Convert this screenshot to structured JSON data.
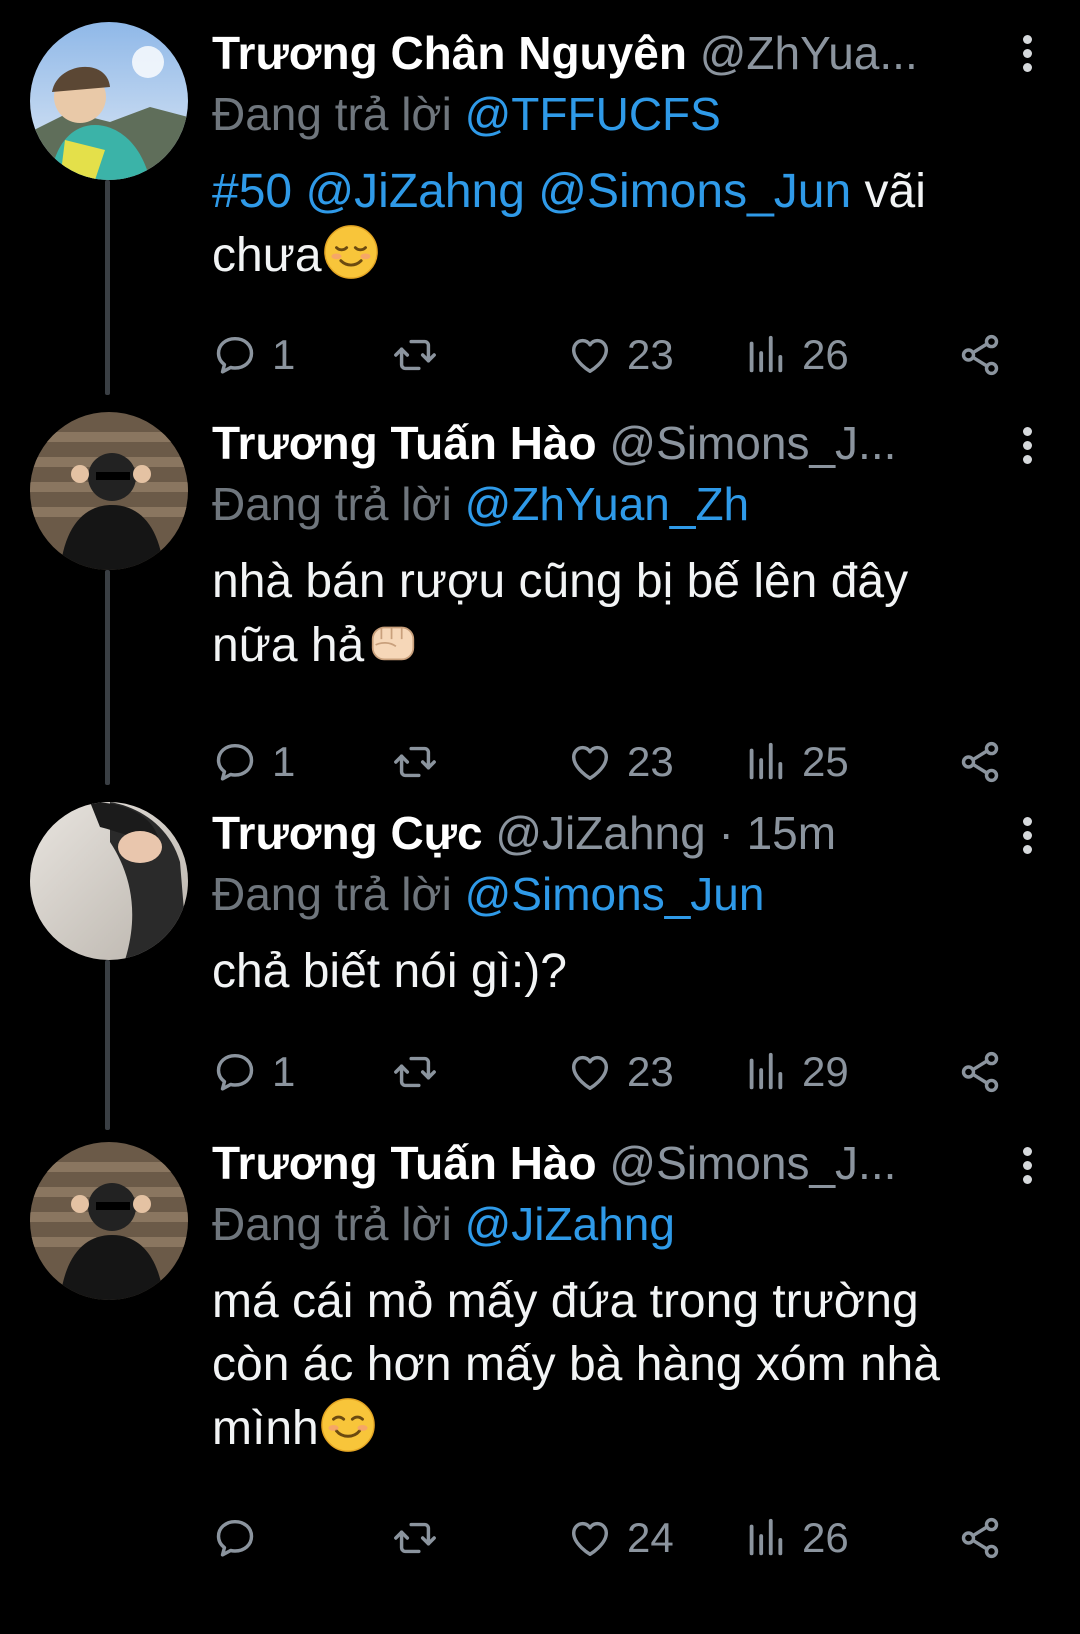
{
  "tweets": [
    {
      "name": "Trương Chân Nguyên",
      "handle": "@ZhYua...",
      "time": "",
      "replying_label": "Đang trả lời",
      "replying_to": "@TFFUCFS",
      "text_parts": {
        "hashtag": "#50",
        "mention1": "@JiZahng",
        "mention2": "@Simons_Jun",
        "tail": "vãi",
        "line2": "chưa",
        "emoji": "relieved-face"
      },
      "counts": {
        "replies": "1",
        "retweets": "",
        "likes": "23",
        "views": "26"
      }
    },
    {
      "name": "Trương Tuấn Hào",
      "handle": "@Simons_J...",
      "time": "",
      "replying_label": "Đang trả lời",
      "replying_to": "@ZhYuan_Zh",
      "text_line1": "nhà bán rượu cũng bị bế lên đây",
      "text_line2": "nữa hả",
      "emoji": "fist-bump",
      "counts": {
        "replies": "1",
        "retweets": "",
        "likes": "23",
        "views": "25"
      }
    },
    {
      "name": "Trương Cực",
      "handle": "@JiZahng",
      "time": "· 15m",
      "replying_label": "Đang trả lời",
      "replying_to": "@Simons_Jun",
      "text_line1": "chả biết nói gì:)?",
      "counts": {
        "replies": "1",
        "retweets": "",
        "likes": "23",
        "views": "29"
      }
    },
    {
      "name": "Trương Tuấn Hào",
      "handle": "@Simons_J...",
      "time": "",
      "replying_label": "Đang trả lời",
      "replying_to": "@JiZahng",
      "text_line1": "má cái mỏ mấy đứa trong trường",
      "text_line2": "còn ác hơn mấy bà hàng xóm nhà",
      "text_line3": "mình",
      "emoji": "smiling-face",
      "counts": {
        "replies": "",
        "retweets": "",
        "likes": "24",
        "views": "26"
      }
    }
  ],
  "colors": {
    "background": "#000000",
    "link": "#2f9ae8",
    "muted": "#8b949e",
    "thread_line": "#3a3f44"
  }
}
